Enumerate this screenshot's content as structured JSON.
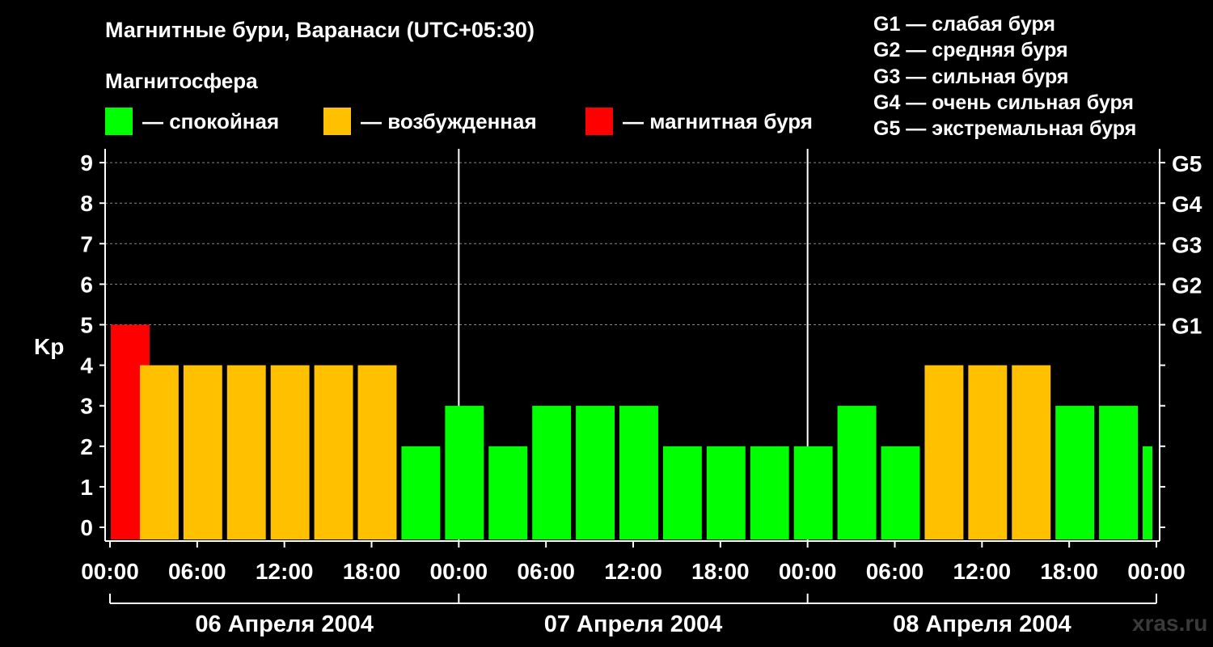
{
  "title": "Магнитные бури, Варанаси (UTC+05:30)",
  "legend": {
    "title": "Магнитосфера",
    "items": [
      {
        "label": "— спокойная",
        "color": "#00ff00"
      },
      {
        "label": "— возбужденная",
        "color": "#ffc000"
      },
      {
        "label": "— магнитная буря",
        "color": "#ff0000"
      }
    ]
  },
  "storm_scale": [
    "G1 — слабая буря",
    "G2 — средняя буря",
    "G3 — сильная буря",
    "G4 — очень сильная буря",
    "G5 — экстремальная буря"
  ],
  "watermark": "xras.ru",
  "chart_data": {
    "type": "bar",
    "ylabel": "Kp",
    "ylim": [
      0,
      9
    ],
    "y_ticks": [
      "0",
      "1",
      "2",
      "3",
      "4",
      "5",
      "6",
      "7",
      "8",
      "9"
    ],
    "right_axis_labels": [
      {
        "kp": 5,
        "label": "G1"
      },
      {
        "kp": 6,
        "label": "G2"
      },
      {
        "kp": 7,
        "label": "G3"
      },
      {
        "kp": 8,
        "label": "G4"
      },
      {
        "kp": 9,
        "label": "G5"
      }
    ],
    "x_tick_labels": [
      "00:00",
      "06:00",
      "12:00",
      "18:00",
      "00:00",
      "06:00",
      "12:00",
      "18:00",
      "00:00",
      "06:00",
      "12:00",
      "18:00",
      "00:00"
    ],
    "days": [
      "06 Апреля 2004",
      "07 Апреля 2004",
      "08 Апреля 2004"
    ],
    "bars": [
      {
        "start": "06 Apr 00:00",
        "value": 5,
        "color": "#ff0000"
      },
      {
        "start": "06 Apr 02:00",
        "value": 4,
        "color": "#ffc000"
      },
      {
        "start": "06 Apr 05:00",
        "value": 4,
        "color": "#ffc000"
      },
      {
        "start": "06 Apr 08:00",
        "value": 4,
        "color": "#ffc000"
      },
      {
        "start": "06 Apr 11:00",
        "value": 4,
        "color": "#ffc000"
      },
      {
        "start": "06 Apr 14:00",
        "value": 4,
        "color": "#ffc000"
      },
      {
        "start": "06 Apr 17:00",
        "value": 4,
        "color": "#ffc000"
      },
      {
        "start": "06 Apr 20:00",
        "value": 2,
        "color": "#00ff00"
      },
      {
        "start": "06 Apr 23:00",
        "value": 3,
        "color": "#00ff00"
      },
      {
        "start": "07 Apr 02:00",
        "value": 2,
        "color": "#00ff00"
      },
      {
        "start": "07 Apr 05:00",
        "value": 3,
        "color": "#00ff00"
      },
      {
        "start": "07 Apr 08:00",
        "value": 3,
        "color": "#00ff00"
      },
      {
        "start": "07 Apr 11:00",
        "value": 3,
        "color": "#00ff00"
      },
      {
        "start": "07 Apr 14:00",
        "value": 2,
        "color": "#00ff00"
      },
      {
        "start": "07 Apr 17:00",
        "value": 2,
        "color": "#00ff00"
      },
      {
        "start": "07 Apr 20:00",
        "value": 2,
        "color": "#00ff00"
      },
      {
        "start": "07 Apr 23:00",
        "value": 2,
        "color": "#00ff00"
      },
      {
        "start": "08 Apr 02:00",
        "value": 3,
        "color": "#00ff00"
      },
      {
        "start": "08 Apr 05:00",
        "value": 2,
        "color": "#00ff00"
      },
      {
        "start": "08 Apr 08:00",
        "value": 4,
        "color": "#ffc000"
      },
      {
        "start": "08 Apr 11:00",
        "value": 4,
        "color": "#ffc000"
      },
      {
        "start": "08 Apr 14:00",
        "value": 4,
        "color": "#ffc000"
      },
      {
        "start": "08 Apr 17:00",
        "value": 3,
        "color": "#00ff00"
      },
      {
        "start": "08 Apr 20:00",
        "value": 3,
        "color": "#00ff00"
      },
      {
        "start": "08 Apr 23:00",
        "value": 2,
        "color": "#00ff00"
      }
    ]
  }
}
